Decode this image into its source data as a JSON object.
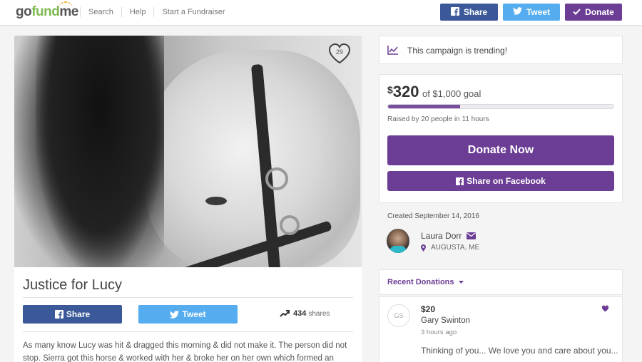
{
  "nav": {
    "logo_go": "go",
    "logo_fund": "fund",
    "logo_me": "me",
    "links": [
      "Search",
      "Help",
      "Start a Fundraiser"
    ],
    "share_label": "Share",
    "tweet_label": "Tweet",
    "donate_label": "Donate"
  },
  "colors": {
    "facebook": "#3b5998",
    "twitter": "#55acee",
    "purple": "#6c3d95",
    "green": "#7db94f"
  },
  "hero": {
    "heart_count": "29"
  },
  "campaign": {
    "title": "Justice for Lucy",
    "share_button": "Share",
    "tweet_button": "Tweet",
    "share_count": "434",
    "share_count_label": "shares",
    "description": "As many know Lucy was hit & dragged this morning & did not make it. The person did not stop. Sierra got this horse & worked with her & broke her on her own which formed an"
  },
  "sidebar": {
    "trending_text": "This campaign is trending!",
    "currency": "$",
    "raised_amount": "320",
    "goal_text": "of $1,000 goal",
    "progress_fraction": 0.32,
    "raised_by": "Raised by 20 people in 11 hours",
    "donate_now": "Donate Now",
    "share_facebook": "Share on Facebook",
    "created": "Created September 14, 2016",
    "organizer_name": "Laura Dorr",
    "organizer_location": "AUGUSTA, ME",
    "recent_donations_label": "Recent Donations",
    "donation": {
      "initials": "GS",
      "amount": "$20",
      "name": "Gary Swinton",
      "time": "3 hours ago",
      "message": "Thinking of you... We love you and care about you..."
    }
  }
}
